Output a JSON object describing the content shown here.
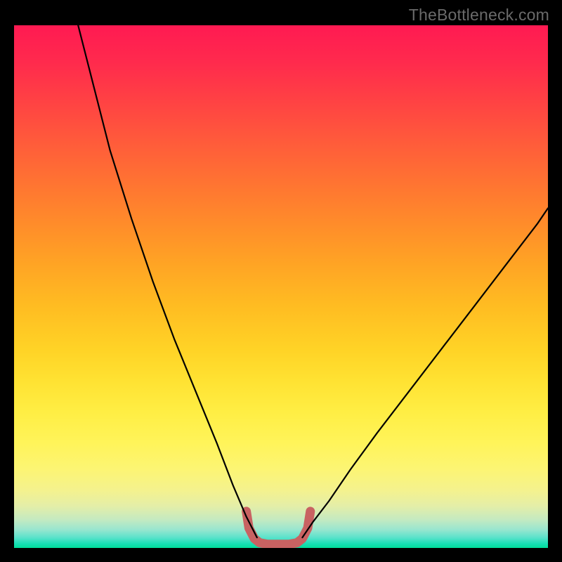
{
  "watermark": "TheBottleneck.com",
  "chart_data": {
    "type": "line",
    "title": "",
    "xlabel": "",
    "ylabel": "",
    "xlim": [
      0,
      100
    ],
    "ylim": [
      0,
      100
    ],
    "series": [
      {
        "name": "left-curve",
        "x": [
          12,
          15,
          18,
          22,
          26,
          30,
          34,
          38,
          41,
          43.5,
          45.5
        ],
        "y": [
          100,
          88,
          76,
          63,
          51,
          40,
          30,
          20,
          12,
          6,
          2
        ]
      },
      {
        "name": "right-curve",
        "x": [
          54,
          56,
          59,
          63,
          68,
          74,
          80,
          86,
          92,
          98,
          100
        ],
        "y": [
          2,
          5,
          9,
          15,
          22,
          30,
          38,
          46,
          54,
          62,
          65
        ]
      },
      {
        "name": "bottom-plateau",
        "x": [
          43.5,
          44,
          45,
          46,
          47.5,
          49.5,
          51.5,
          53,
          54,
          55,
          55.5
        ],
        "y": [
          7,
          3.8,
          1.8,
          1.0,
          0.7,
          0.7,
          0.7,
          1.0,
          1.8,
          3.8,
          7
        ]
      }
    ],
    "styles": {
      "left-curve": {
        "stroke": "#000000",
        "width": 2.2
      },
      "right-curve": {
        "stroke": "#000000",
        "width": 2.2
      },
      "bottom-plateau": {
        "stroke": "#c86262",
        "width": 13
      }
    },
    "background_gradient": {
      "top": "#ff1a52",
      "mid": "#ffe232",
      "bottom": "#00dd9a"
    }
  }
}
